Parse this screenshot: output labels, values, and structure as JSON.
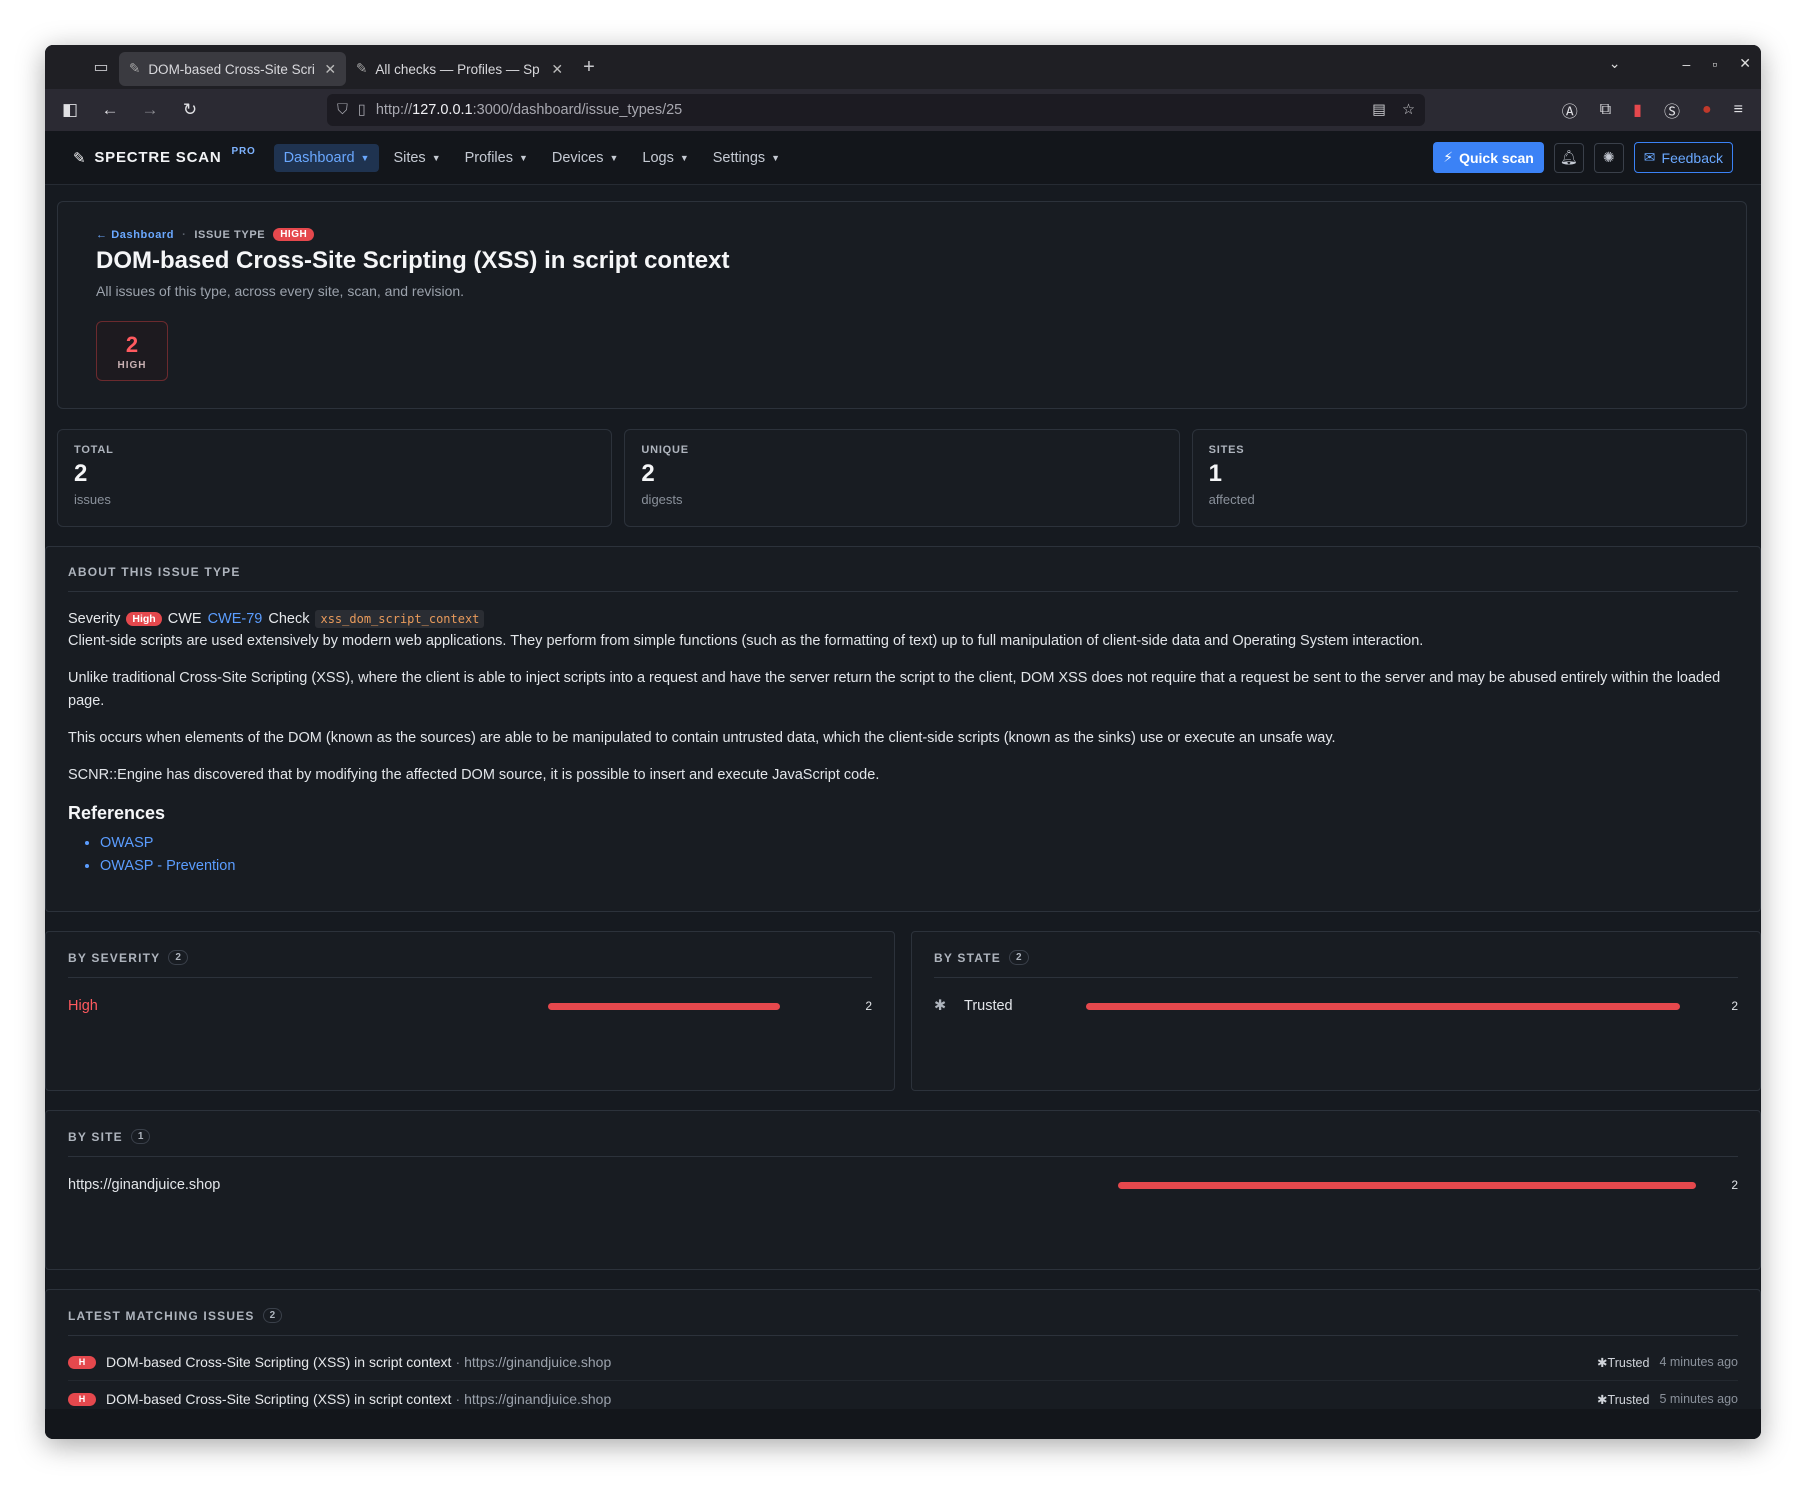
{
  "browser": {
    "tabs": [
      {
        "title": "DOM-based Cross-Site Scri",
        "active": true
      },
      {
        "title": "All checks — Profiles — Sp",
        "active": false
      }
    ],
    "url_prefix": "http://",
    "url_host": "127.0.0.1",
    "url_path": ":3000/dashboard/issue_types/25"
  },
  "app": {
    "brand": "SPECTRE SCAN",
    "brand_tag": "PRO",
    "nav": [
      "Dashboard",
      "Sites",
      "Profiles",
      "Devices",
      "Logs",
      "Settings"
    ],
    "quick_scan": "Quick scan",
    "feedback": "Feedback"
  },
  "hero": {
    "back": "← Dashboard",
    "crumb_sep": "·",
    "issue_type_label": "ISSUE TYPE",
    "severity_badge": "HIGH",
    "title": "DOM-based Cross-Site Scripting (XSS) in script context",
    "subtitle": "All issues of this type, across every site, scan, and revision.",
    "sev_count": "2",
    "sev_label": "HIGH"
  },
  "stats": [
    {
      "label": "TOTAL",
      "value": "2",
      "unit": "issues"
    },
    {
      "label": "UNIQUE",
      "value": "2",
      "unit": "digests"
    },
    {
      "label": "SITES",
      "value": "1",
      "unit": "affected"
    }
  ],
  "about": {
    "title": "ABOUT THIS ISSUE TYPE",
    "severity_label": "Severity",
    "severity_value": "High",
    "cwe_label": "CWE",
    "cwe_value": "CWE-79",
    "check_label": "Check",
    "check_value": "xss_dom_script_context",
    "paragraphs": [
      "Client-side scripts are used extensively by modern web applications. They perform from simple functions (such as the formatting of text) up to full manipulation of client-side data and Operating System interaction.",
      "Unlike traditional Cross-Site Scripting (XSS), where the client is able to inject scripts into a request and have the server return the script to the client, DOM XSS does not require that a request be sent to the server and may be abused entirely within the loaded page.",
      "This occurs when elements of the DOM (known as the sources) are able to be manipulated to contain untrusted data, which the client-side scripts (known as the sinks) use or execute an unsafe way.",
      "SCNR::Engine has discovered that by modifying the affected DOM source, it is possible to insert and execute JavaScript code."
    ],
    "references_title": "References",
    "references": [
      "OWASP",
      "OWASP - Prevention"
    ]
  },
  "by_severity": {
    "title": "BY SEVERITY",
    "count": "2",
    "rows": [
      {
        "label": "High",
        "value": "2",
        "fraction": 1.0
      }
    ]
  },
  "by_state": {
    "title": "BY STATE",
    "count": "2",
    "rows": [
      {
        "label": "Trusted",
        "value": "2",
        "fraction": 1.0
      }
    ]
  },
  "by_site": {
    "title": "BY SITE",
    "count": "1",
    "rows": [
      {
        "label": "https://ginandjuice.shop",
        "value": "2",
        "fraction": 1.0
      }
    ]
  },
  "latest": {
    "title": "LATEST MATCHING ISSUES",
    "count": "2",
    "items": [
      {
        "sev": "H",
        "title": "DOM-based Cross-Site Scripting (XSS) in script context",
        "site": "https://ginandjuice.shop",
        "state": "Trusted",
        "time": "4 minutes ago"
      },
      {
        "sev": "H",
        "title": "DOM-based Cross-Site Scripting (XSS) in script context",
        "site": "https://ginandjuice.shop",
        "state": "Trusted",
        "time": "5 minutes ago"
      }
    ]
  },
  "colors": {
    "accent": "#3b82f6",
    "high": "#e5484d",
    "bg": "#161a20"
  }
}
